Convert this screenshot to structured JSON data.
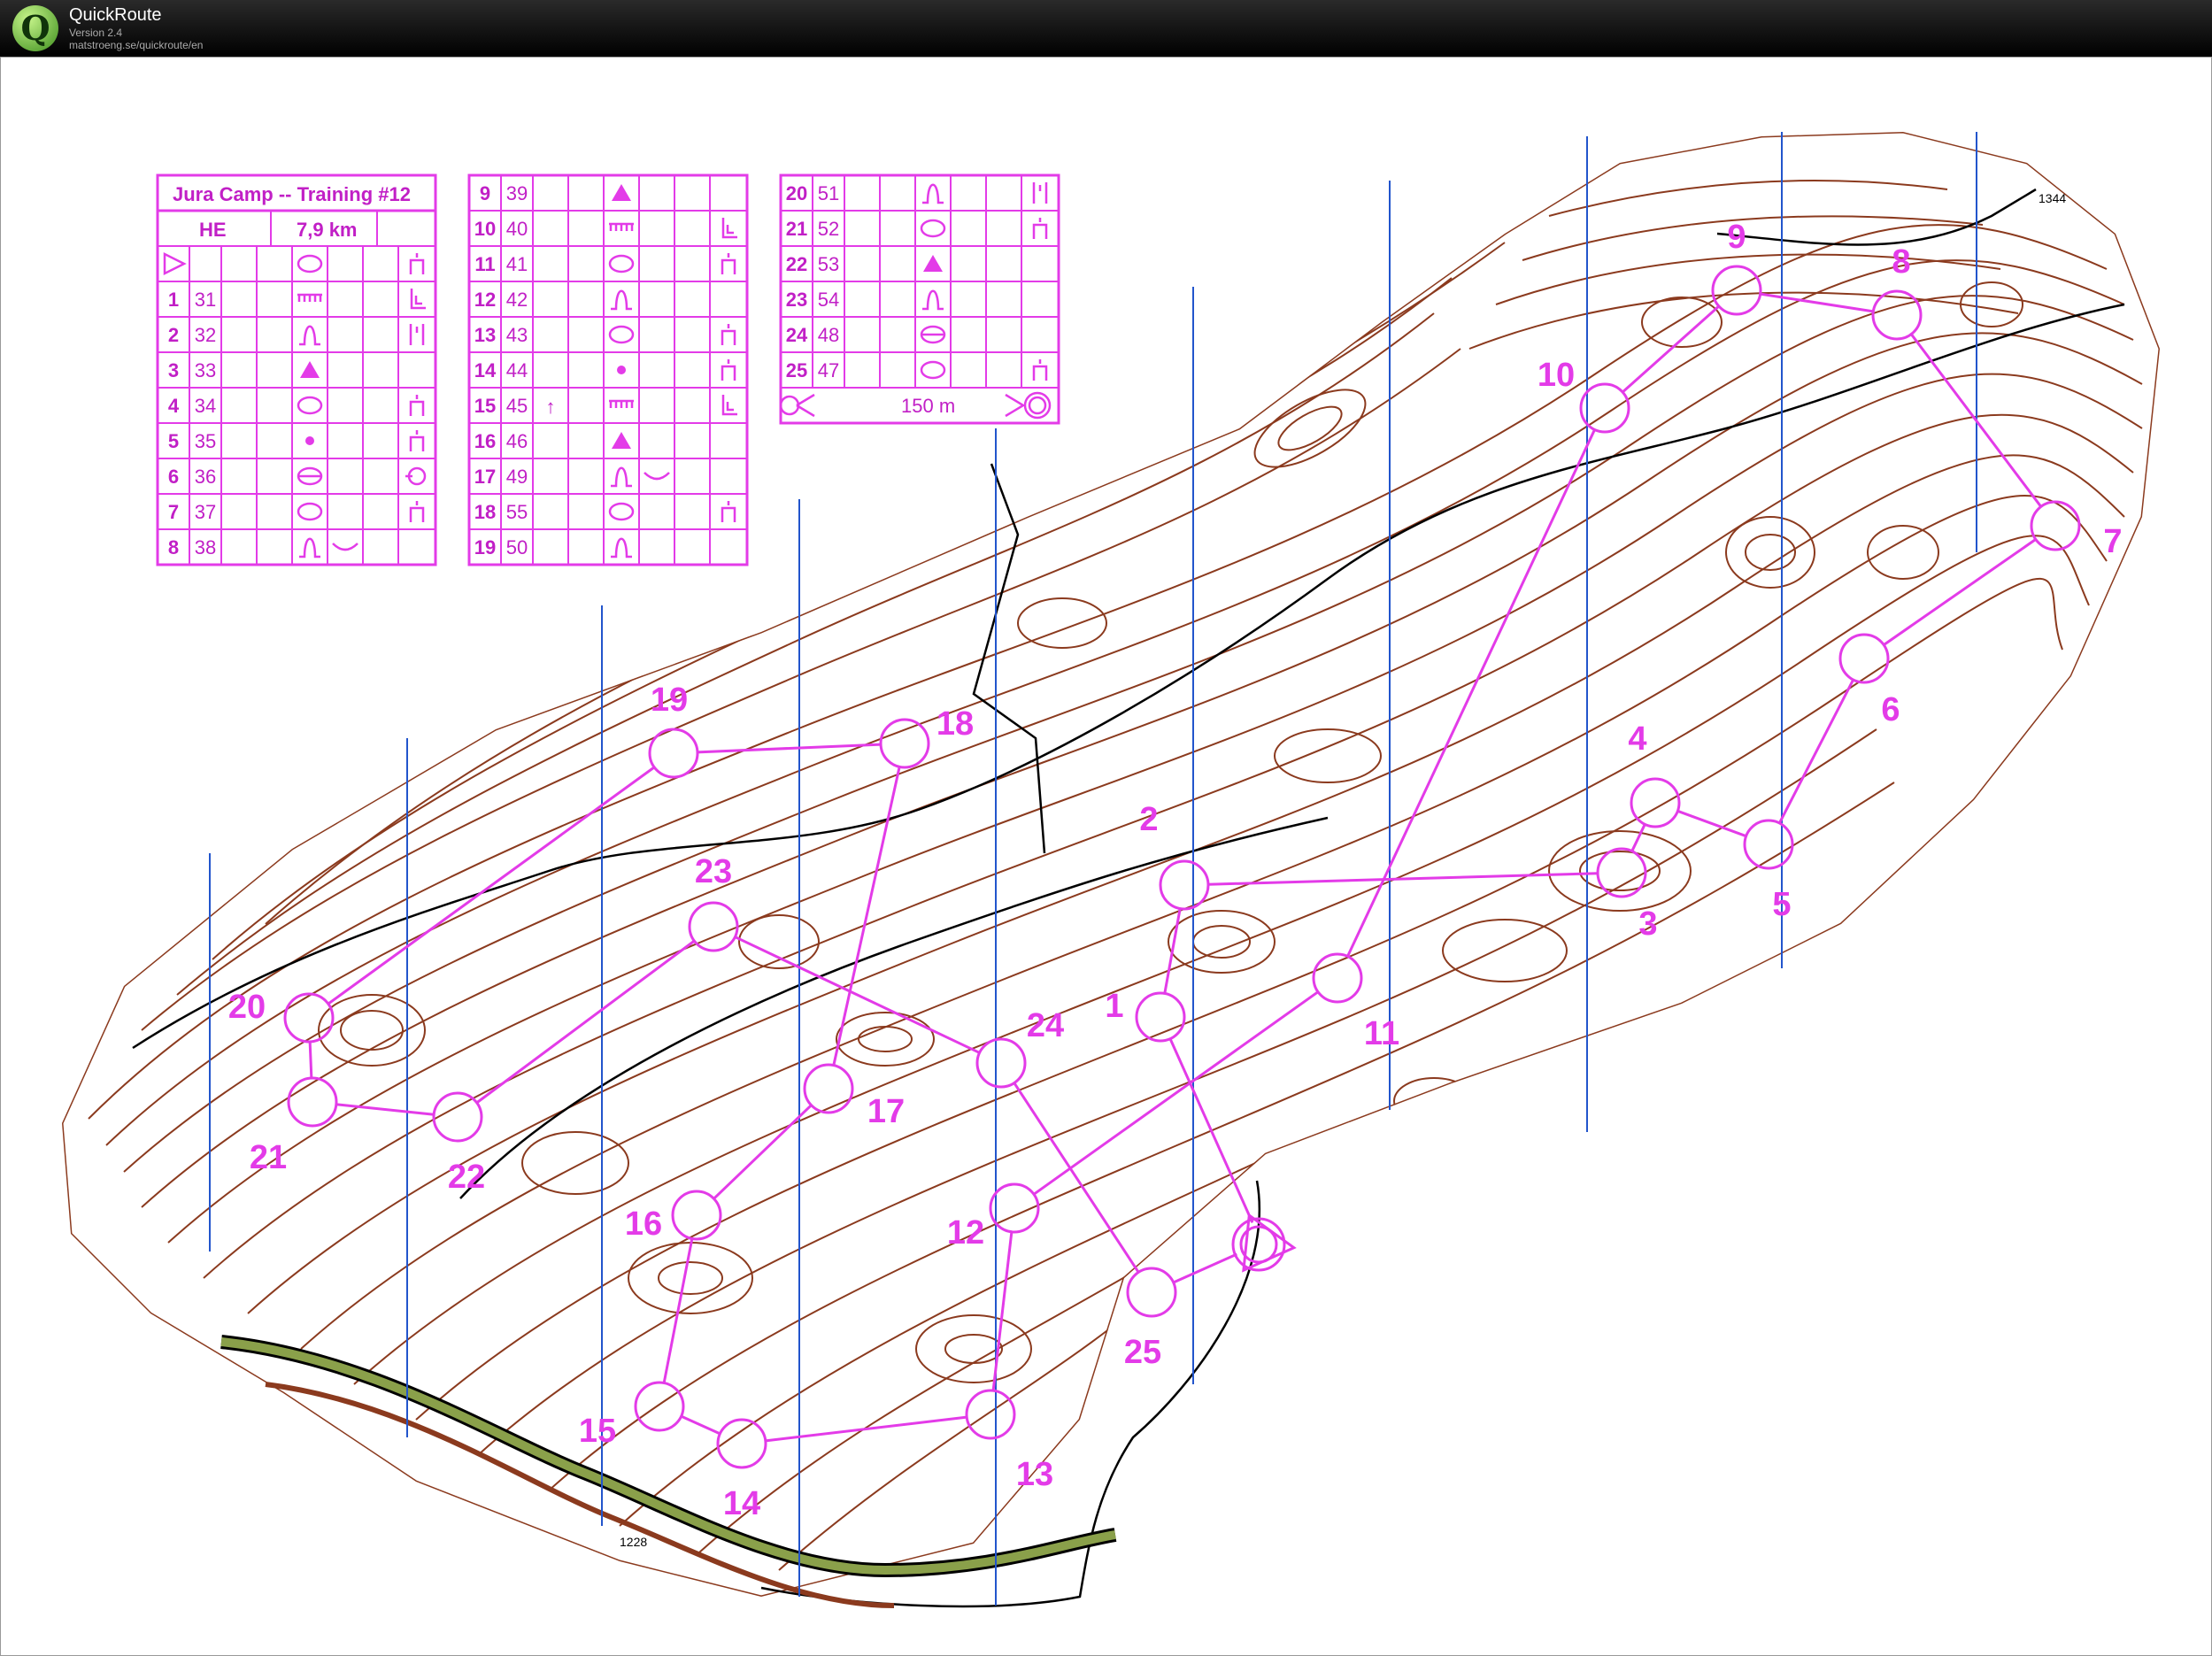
{
  "app": {
    "name": "QuickRoute",
    "version": "Version 2.4",
    "url": "matstroeng.se/quickroute/en"
  },
  "colors": {
    "course": "#e33be8",
    "contour": "#8b3a1e",
    "magnetic_north": "#2255cc"
  },
  "course": {
    "title": "Jura Camp -- Training #12",
    "class": "HE",
    "length": "7,9 km",
    "finish_distance": "150 m",
    "controls": [
      {
        "n": "1",
        "code": "31",
        "feature": "step-icon",
        "loc": "corner-icon"
      },
      {
        "n": "2",
        "code": "32",
        "feature": "spur-icon",
        "loc": "between-icon"
      },
      {
        "n": "3",
        "code": "33",
        "feature": "knoll-icon",
        "loc": ""
      },
      {
        "n": "4",
        "code": "34",
        "feature": "depression-icon",
        "loc": "foot-icon"
      },
      {
        "n": "5",
        "code": "35",
        "feature": "dot-knoll-icon",
        "loc": "foot-icon"
      },
      {
        "n": "6",
        "code": "36",
        "feature": "pit-icon",
        "loc": "part-icon"
      },
      {
        "n": "7",
        "code": "37",
        "feature": "depression-icon",
        "loc": "foot-icon"
      },
      {
        "n": "8",
        "code": "38",
        "feature": "spur-icon",
        "loc": "curve-icon"
      },
      {
        "n": "9",
        "code": "39",
        "feature": "knoll-icon",
        "loc": ""
      },
      {
        "n": "10",
        "code": "40",
        "feature": "step-icon",
        "loc": "corner-icon"
      },
      {
        "n": "11",
        "code": "41",
        "feature": "depression-icon",
        "loc": "foot-icon"
      },
      {
        "n": "12",
        "code": "42",
        "feature": "spur-icon",
        "loc": ""
      },
      {
        "n": "13",
        "code": "43",
        "feature": "depression-icon",
        "loc": "foot-icon"
      },
      {
        "n": "14",
        "code": "44",
        "feature": "dot-knoll-icon",
        "loc": "foot-icon"
      },
      {
        "n": "15",
        "code": "45",
        "feature": "step-icon",
        "loc": "corner-icon",
        "dir": "↑"
      },
      {
        "n": "16",
        "code": "46",
        "feature": "knoll-icon",
        "loc": ""
      },
      {
        "n": "17",
        "code": "49",
        "feature": "spur-icon",
        "loc": "curve-icon"
      },
      {
        "n": "18",
        "code": "55",
        "feature": "depression-icon",
        "loc": "foot-icon"
      },
      {
        "n": "19",
        "code": "50",
        "feature": "spur-icon",
        "loc": ""
      },
      {
        "n": "20",
        "code": "51",
        "feature": "spur-icon",
        "loc": "between-icon"
      },
      {
        "n": "21",
        "code": "52",
        "feature": "depression-icon",
        "loc": "foot-icon"
      },
      {
        "n": "22",
        "code": "53",
        "feature": "knoll-icon",
        "loc": ""
      },
      {
        "n": "23",
        "code": "54",
        "feature": "spur-icon",
        "loc": ""
      },
      {
        "n": "24",
        "code": "48",
        "feature": "pit-icon",
        "loc": ""
      },
      {
        "n": "25",
        "code": "47",
        "feature": "depression-icon",
        "loc": "foot-icon"
      }
    ]
  },
  "map_labels": {
    "elevation_ne": "1344",
    "elevation_s": "1228"
  },
  "legs": [
    "S",
    "1",
    "2",
    "3",
    "4",
    "5",
    "6",
    "7",
    "8",
    "9",
    "10",
    "11",
    "12",
    "13",
    "14",
    "15",
    "16",
    "17",
    "18",
    "19",
    "20",
    "21",
    "22",
    "23",
    "24",
    "25",
    "F"
  ]
}
